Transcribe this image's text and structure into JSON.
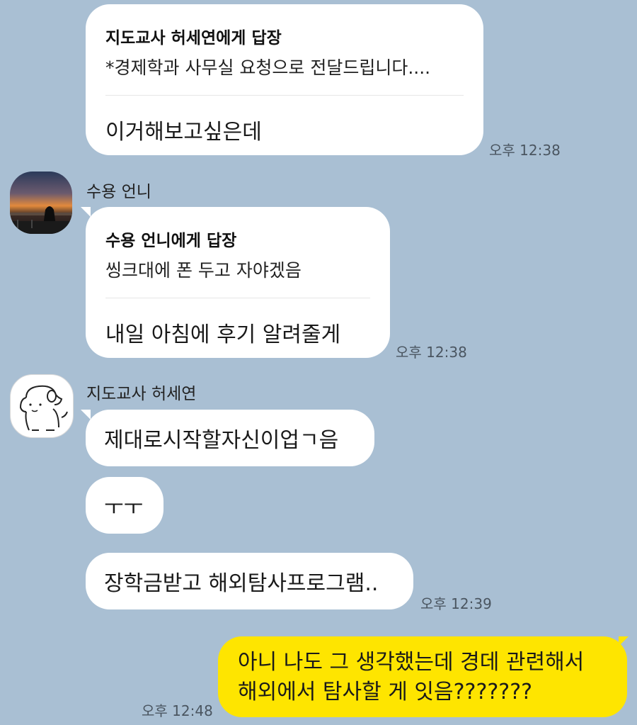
{
  "messages": [
    {
      "reply_header": "지도교사 허세연에게 답장",
      "reply_quote": "*경제학과 사무실 요청으로 전달드립니다....",
      "text": "이거해보고싶은데",
      "time": "오후 12:38"
    },
    {
      "sender": "수용 언니",
      "reply_header": "수용 언니에게 답장",
      "reply_quote": "씽크대에 폰 두고 자야겠음",
      "text": "내일 아침에 후기 알려줄게",
      "time": "오후 12:38"
    },
    {
      "sender": "지도교사 허세연",
      "texts": [
        "제대로시작할자신이업ㄱ음",
        "ㅜㅜ",
        "장학금받고 해외탐사프로그램.."
      ],
      "time": "오후 12:39"
    },
    {
      "lines": [
        "아니 나도 그 생각했는데 경데 관련해서",
        "해외에서 탐사할 게 잇음???????"
      ],
      "time": "오후 12:48"
    }
  ],
  "icons": {
    "avatar_1": "sunset-photo-avatar",
    "avatar_2": "cartoon-dog-avatar"
  },
  "colors": {
    "background": "#a9bfd3",
    "my_bubble": "#fee500",
    "other_bubble": "#ffffff"
  }
}
